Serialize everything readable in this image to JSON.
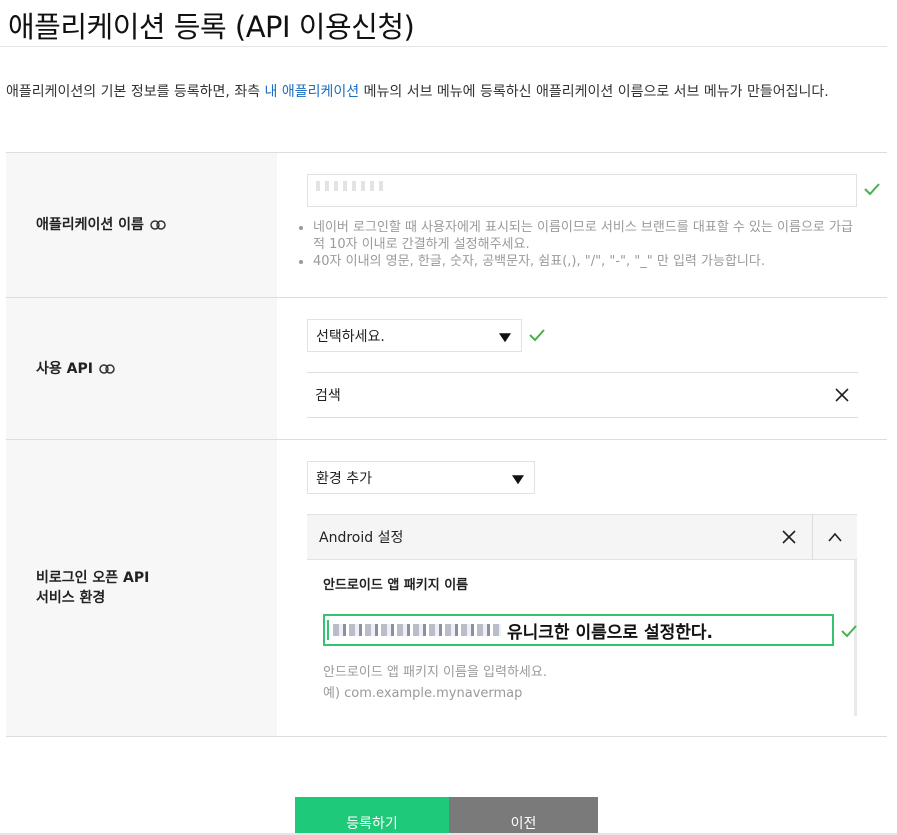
{
  "page": {
    "title": "애플리케이션 등록 (API 이용신청)"
  },
  "intro": {
    "before": "애플리케이션의 기본 정보를 등록하면, 좌측 ",
    "link": "내 애플리케이션",
    "after": " 메뉴의 서브 메뉴에 등록하신 애플리케이션 이름으로 서브 메뉴가 만들어집니다."
  },
  "form": {
    "app_name": {
      "label": "애플리케이션 이름",
      "hints": [
        "네이버 로그인할 때 사용자에게 표시되는 이름이므로 서비스 브랜드를 대표할 수 있는 이름으로 가급적 10자 이내로 간결하게 설정해주세요.",
        "40자 이내의 영문, 한글, 숫자, 공백문자, 쉼표(,), \"/\", \"-\", \"_\" 만 입력 가능합니다."
      ]
    },
    "api": {
      "label": "사용 API",
      "select_value": "선택하세요.",
      "selected_item": "검색"
    },
    "env": {
      "label_line1": "비로그인 오픈 API",
      "label_line2": "서비스 환경",
      "select_value": "환경 추가",
      "panel_title": "Android 설정",
      "package_label": "안드로이드 앱 패키지 이름",
      "package_annotation": "유니크한 이름으로 설정한다.",
      "package_hint_line1": "안드로이드 앱 패키지 이름을 입력하세요.",
      "package_hint_line2": "예) com.example.mynavermap"
    }
  },
  "buttons": {
    "register": "등록하기",
    "prev": "이전"
  },
  "colors": {
    "accent_green": "#1fc97a",
    "check_green": "#4caf50",
    "link_blue": "#1b6ec2",
    "prev_gray": "#7a7a7a"
  },
  "icons": [
    "link-icon",
    "check-icon",
    "chevron-down-icon",
    "close-icon",
    "chevron-up-icon"
  ]
}
